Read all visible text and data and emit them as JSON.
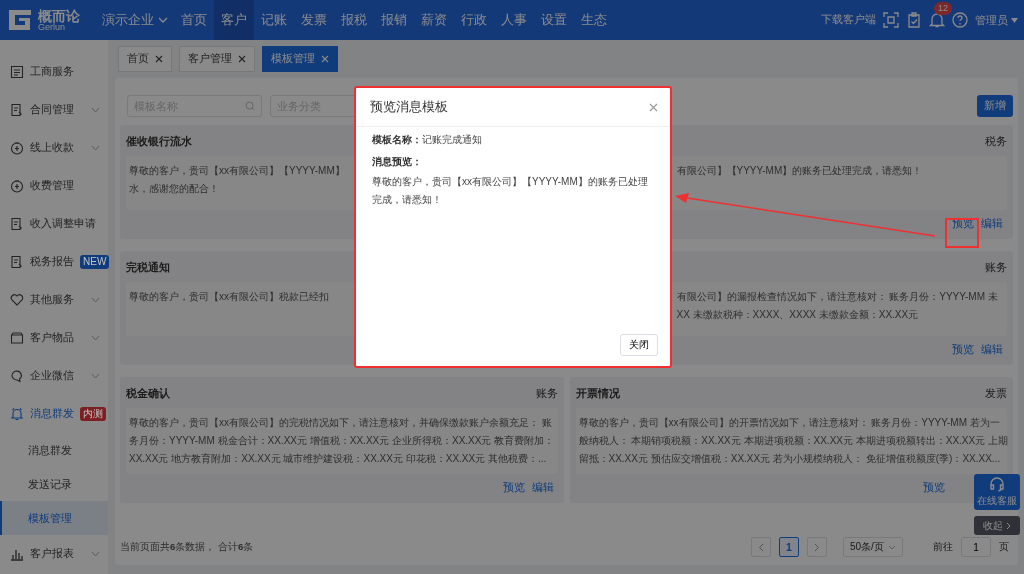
{
  "header": {
    "logo_name": "概而论",
    "logo_sub": "Gerlun",
    "company": "演示企业",
    "nav": [
      {
        "label": "首页",
        "selected": false
      },
      {
        "label": "客户",
        "selected": true
      },
      {
        "label": "记账",
        "selected": false
      },
      {
        "label": "发票",
        "selected": false
      },
      {
        "label": "报税",
        "selected": false
      },
      {
        "label": "报销",
        "selected": false
      },
      {
        "label": "薪资",
        "selected": false
      },
      {
        "label": "行政",
        "selected": false
      },
      {
        "label": "人事",
        "selected": false
      },
      {
        "label": "设置",
        "selected": false
      },
      {
        "label": "生态",
        "selected": false
      }
    ],
    "download": "下载客户端",
    "notification_count": "12",
    "user": "管理员"
  },
  "sidebar": {
    "items": [
      {
        "label": "工商服务"
      },
      {
        "label": "合同管理",
        "expanded": false
      },
      {
        "label": "线上收款",
        "expanded": false
      },
      {
        "label": "收费管理"
      },
      {
        "label": "收入调整申请"
      },
      {
        "label": "税务报告",
        "badge": {
          "text": "NEW",
          "color": "#113c7c"
        }
      },
      {
        "label": "其他服务",
        "expanded": false
      },
      {
        "label": "客户物品",
        "expanded": false
      },
      {
        "label": "企业微信",
        "expanded": false
      },
      {
        "label": "消息群发",
        "badge": {
          "text": "内测",
          "color": "#7c1f20"
        },
        "expanded": true,
        "children": [
          {
            "label": "消息群发",
            "selected": false
          },
          {
            "label": "发送记录",
            "selected": false
          },
          {
            "label": "模板管理",
            "selected": true
          }
        ]
      },
      {
        "label": "客户报表",
        "expanded": false
      }
    ]
  },
  "tabs": [
    {
      "label": "首页",
      "selected": false
    },
    {
      "label": "客户管理",
      "selected": false
    },
    {
      "label": "模板管理",
      "selected": true
    }
  ],
  "filters": {
    "name_placeholder": "模板名称",
    "category_placeholder": "业务分类",
    "add_button": "新增"
  },
  "cards": [
    {
      "title": "催收银行流水",
      "lines": [
        "尊敬的客户，贵司【xx有限公司】【YYYY-MM】",
        "水，感谢您的配合！"
      ]
    },
    {
      "category": "税务",
      "lines": [
        "有限公司】【YYYY-MM】的账务已处理完成，请悉知！"
      ],
      "actions": [
        "预览",
        "编辑"
      ]
    },
    {
      "title": "完税通知",
      "lines": [
        "尊敬的客户，贵司【xx有限公司】税款已经扣"
      ]
    },
    {
      "category": "账务",
      "lines": [
        "有限公司】的漏报检查情况如下，请注意核对： 账务月份：YYYY-MM 未",
        "XX 未缴款税种：XXXX、XXXX 未缴款金额：XX.XX元"
      ],
      "actions": [
        "预览",
        "编辑"
      ]
    },
    {
      "title": "税金确认",
      "category": "账务",
      "lines": [
        "尊敬的客户，贵司【xx有限公司】的完税情况如下，请注意核对，并确保缴款账户余额充足： 账",
        "务月份：YYYY-MM 税金合计：XX.XX元 增值税：XX.XX元 企业所得税：XX.XX元 教育费附加：",
        "XX.XX元 地方教育附加：XX.XX元 城市维护建设税：XX.XX元 印花税：XX.XX元 其他税费：..."
      ],
      "actions": [
        "预览",
        "编辑"
      ]
    },
    {
      "title": "开票情况",
      "category": "发票",
      "lines": [
        "尊敬的客户，贵司【xx有限公司】的开票情况如下，请注意核对： 账务月份：YYYY-MM 若为一",
        "般纳税人： 本期销项税额：XX.XX元 本期进项税额：XX.XX元 本期进项税额转出：XX.XX元 上期",
        "留抵：XX.XX元 预估应交增值税：XX.XX元 若为小规模纳税人： 免征增值税额度(季)：XX.XX..."
      ],
      "actions": [
        "预览"
      ]
    }
  ],
  "footer": {
    "summary": "当前页面共**6**条数据， 合计**6**条",
    "pages": [
      {
        "label": "1",
        "selected": true
      }
    ],
    "page_size": "50条/页",
    "goto_label": "前往",
    "goto_value": "1",
    "goto_suffix": "页"
  },
  "modal": {
    "title": "预览消息模板",
    "name_label": "模板名称：",
    "name_value": "记账完成通知",
    "preview_label": "消息预览：",
    "preview_text": "尊敬的客户，贵司【xx有限公司】【YYYY-MM】的账务已处理完成，请悉知！",
    "close_button": "关闭"
  },
  "float": {
    "service": "在线客服",
    "collapse": "收起"
  }
}
